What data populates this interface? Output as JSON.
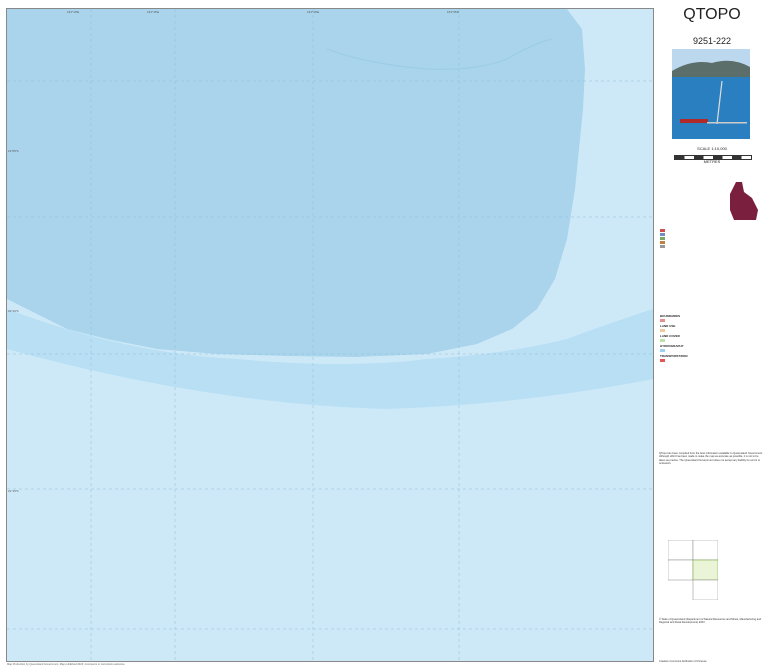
{
  "map": {
    "colors": {
      "sea": "#cde9f8",
      "deep_sea": "#a9d4ec",
      "sandbank": "#b3dcf2",
      "grid": "#8fbfd9"
    },
    "top_ticks": [
      "151°10'E",
      "151°15'E",
      "151°20'E",
      "151°25'E"
    ],
    "left_ticks": [
      "21°05'S",
      "21°10'S",
      "21°15'S"
    ],
    "footer": "Map Production by Queensland Government. Map published 2023. Comments or corrections welcome."
  },
  "panel": {
    "title": "QTOPO",
    "sheet_number": "9251-222",
    "scale": "SCALE 1:10,000",
    "scale_unit": "METRES",
    "legend_headings": [
      "BOUNDARIES",
      "LAND USE",
      "LAND COVER",
      "HYDROGRAPHY",
      "TRANSPORTATION"
    ],
    "disclaimer": "QTopo has been compiled from the best information available to Queensland Government. Although effort has been made to make the map as accurate as possible, it is not to be taken as precise. The Queensland Government does not accept any liability for errors or omissions.",
    "copyright": "© State of Queensland (Department of Natural Resources and Mines, Manufacturing and Regional and Rural Development) 2023",
    "index_cells": [
      "9251-224",
      "9251-221",
      "9251-223",
      "9251-222",
      "9351-333"
    ],
    "license_text": "Creative Commons Attribution 4.0 licence"
  }
}
